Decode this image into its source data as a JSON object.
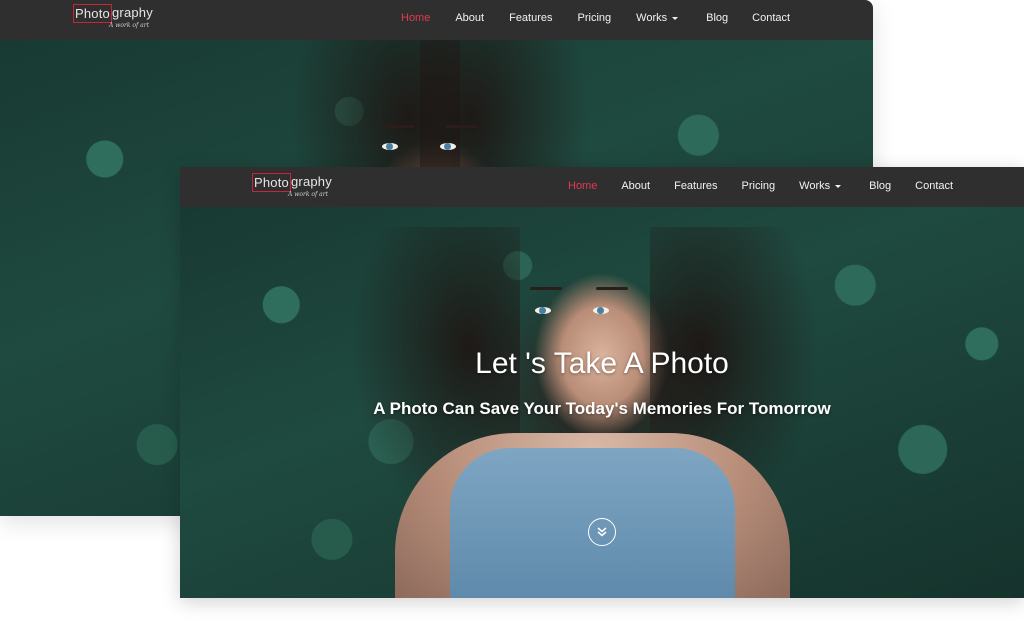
{
  "logo": {
    "part1": "Photo",
    "part2": "graphy",
    "tagline": "A work of art"
  },
  "nav": {
    "items": [
      {
        "label": "Home",
        "active": true
      },
      {
        "label": "About"
      },
      {
        "label": "Features"
      },
      {
        "label": "Pricing"
      },
      {
        "label": "Works",
        "dropdown": true
      },
      {
        "label": "Blog"
      },
      {
        "label": "Contact"
      }
    ]
  },
  "hero": {
    "title": "Let 's Take A Photo",
    "subtitle": "A Photo Can Save Your Today's Memories For Tomorrow",
    "scroll_icon": "chevron-double-down-icon"
  },
  "colors": {
    "navbar": "#2f2f2f",
    "accent": "#e23850",
    "text": "#ffffff"
  }
}
